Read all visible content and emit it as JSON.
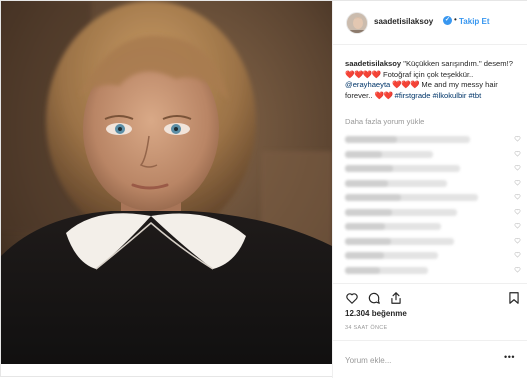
{
  "post": {
    "username": "saadetisilaksoy",
    "verified": true,
    "follow_label": "Takip Et",
    "dot": "•"
  },
  "caption": {
    "username": "saadetisilaksoy",
    "part1": "\"Küçükken sarışındım.\" desem!?",
    "faint1": "❤️❤️❤️❤️",
    "part2": "Fotoğraf için çok teşekkür..",
    "mention": "@erayhaeyta",
    "faint2": "❤️❤️❤️",
    "part3": "Me and my messy hair forever..",
    "faint3": "❤️❤️",
    "hashtag1": "#firstgrade",
    "hashtag2": "#ilkokulbir",
    "hashtag3": "#tbt"
  },
  "load_more": "Daha fazla yorum yükle",
  "comments": [
    {
      "text": "",
      "blur": 0.78
    },
    {
      "text": "",
      "blur": 0.55
    },
    {
      "text": "",
      "blur": 0.72
    },
    {
      "text": "",
      "blur": 0.64
    },
    {
      "text": "",
      "blur": 0.83
    },
    {
      "text": "",
      "blur": 0.7
    },
    {
      "text": "",
      "blur": 0.6
    },
    {
      "text": "",
      "blur": 0.68
    },
    {
      "text": "",
      "blur": 0.58
    },
    {
      "text": "",
      "blur": 0.52
    }
  ],
  "actions": {
    "like_icon": "heart-icon",
    "comment_icon": "comment-icon",
    "share_icon": "share-icon",
    "save_icon": "bookmark-icon"
  },
  "likes": "12.304 beğenme",
  "time": "34 SAAT ÖNCE",
  "add_comment_placeholder": "Yorum ekle...",
  "more_label": "•••",
  "colors": {
    "accent": "#3897f0",
    "text": "#262626",
    "muted": "#999999",
    "hashtag": "#003569",
    "border": "#efefef"
  }
}
